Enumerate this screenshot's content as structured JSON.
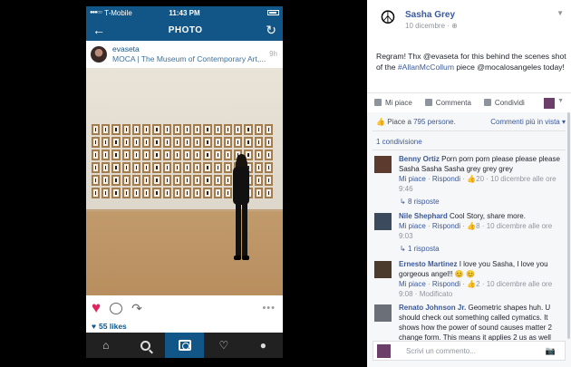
{
  "phone": {
    "carrier": "T-Mobile",
    "time": "11:43 PM",
    "header_title": "PHOTO",
    "username": "evaseta",
    "location": "MOCA | The Museum of Contemporary Art,...",
    "post_time": "9h",
    "likes": "55 likes"
  },
  "fb": {
    "page_name": "Sasha Grey",
    "date": "10 dicembre",
    "text_pre": "Regram! Thx @evaseta for this behind the scenes shot of the ",
    "hashtag": "#AllanMcCollum",
    "text_post": " piece @mocalosangeles today!",
    "actions": {
      "like": "Mi piace",
      "comment": "Commenta",
      "share": "Condividi"
    },
    "likes_prefix": "Piace a ",
    "likes_link": "795 persone.",
    "comments_view": "Commenti più in vista ▾",
    "shares": "1 condivisione",
    "comments": [
      {
        "name": "Benny Ortiz",
        "text": "Porn porn porn please please please Sasha Sasha Sasha grey grey grey",
        "like": "Mi piace",
        "reply": "Rispondi",
        "count": "20",
        "time": "10 dicembre alle ore 9:46",
        "replies": "8 risposte"
      },
      {
        "name": "Nile Shephard",
        "text": "Cool Story, share more.",
        "like": "Mi piace",
        "reply": "Rispondi",
        "count": "8",
        "time": "10 dicembre alle ore 9:03",
        "replies": "1 risposta"
      },
      {
        "name": "Ernesto Martinez",
        "text": "I love you Sasha, I love you gorgeous angel!! 😊 😊",
        "like": "Mi piace",
        "reply": "Rispondi",
        "count": "2",
        "time": "10 dicembre alle ore 9:08",
        "edited": "Modificato"
      },
      {
        "name": "Renato Johnson Jr.",
        "text": "Geometric shapes huh. U should check out something called cymatics. It shows how the power of sound causes matter 2 change form. This means it applies 2 us as well"
      }
    ],
    "write_placeholder": "Scrivi un commento..."
  }
}
